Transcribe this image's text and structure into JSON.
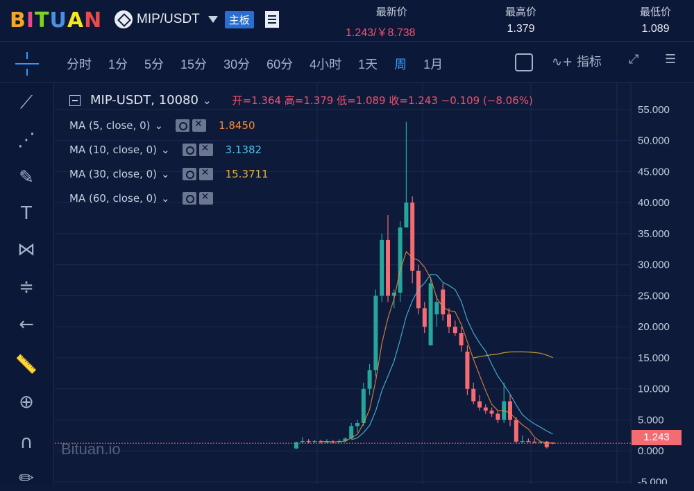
{
  "header": {
    "logo": "BITUAN",
    "pair": "MIP/USDT",
    "board": "主板",
    "latest_label": "最新价",
    "latest_value": "1.243/￥8.738",
    "high_label": "最高价",
    "high_value": "1.379",
    "low_label": "最低价",
    "low_value": "1.089"
  },
  "toolbar": {
    "intervals": [
      "分时",
      "1分",
      "5分",
      "15分",
      "30分",
      "60分",
      "4小时",
      "1天",
      "周",
      "1月"
    ],
    "active_interval": "周",
    "indicator_label": "指标"
  },
  "legend": {
    "symbol": "MIP-USDT, 10080",
    "ohlc_text": "开=1.364  高=1.379  低=1.089  收=1.243  −0.109 (−8.06%)",
    "ma": [
      {
        "label": "MA (5, close, 0)",
        "value": "1.8450",
        "color": "#f08a3c"
      },
      {
        "label": "MA (10, close, 0)",
        "value": "3.1382",
        "color": "#4fc3e8"
      },
      {
        "label": "MA (30, close, 0)",
        "value": "15.3711",
        "color": "#e0b030"
      },
      {
        "label": "MA (60, close, 0)",
        "value": "",
        "color": "#c7d0e0"
      }
    ]
  },
  "watermark": "Bituan.io",
  "last_price_badge": "1.243",
  "colors": {
    "up": "#26a69a",
    "down": "#f56b72",
    "bg": "#0d1a3a"
  },
  "chart_data": {
    "type": "candlestick",
    "ylim": [
      -5,
      57
    ],
    "yticks": [
      "55.000",
      "50.000",
      "45.000",
      "40.000",
      "35.000",
      "30.000",
      "25.000",
      "20.000",
      "15.000",
      "10.000",
      "5.000",
      "0.000",
      "-5.000"
    ],
    "ytick_values": [
      55,
      50,
      45,
      40,
      35,
      30,
      25,
      20,
      15,
      10,
      5,
      0,
      -5
    ],
    "candles": [
      [
        0.4,
        1.5,
        0.3,
        1.4
      ],
      [
        1.4,
        2.2,
        1.2,
        1.6
      ],
      [
        1.6,
        1.9,
        1.2,
        1.5
      ],
      [
        1.5,
        1.8,
        1.3,
        1.6
      ],
      [
        1.6,
        1.8,
        1.2,
        1.4
      ],
      [
        1.4,
        1.9,
        1.3,
        1.5
      ],
      [
        1.5,
        1.8,
        1.3,
        1.4
      ],
      [
        1.4,
        1.9,
        1.3,
        1.6
      ],
      [
        1.6,
        2.2,
        1.4,
        2.0
      ],
      [
        2.0,
        4.5,
        1.9,
        4.0
      ],
      [
        4.0,
        5.0,
        3.0,
        4.5
      ],
      [
        4.5,
        11.0,
        4.0,
        10.0
      ],
      [
        10.0,
        14.0,
        9.0,
        13.0
      ],
      [
        13.0,
        26.0,
        12.0,
        25.0
      ],
      [
        25.0,
        35.0,
        24.0,
        34.0
      ],
      [
        34.0,
        38.0,
        24.0,
        25.0
      ],
      [
        25.0,
        26.0,
        23.0,
        25.5
      ],
      [
        25.5,
        37.0,
        24.0,
        36.0
      ],
      [
        36.0,
        53.0,
        36.0,
        40.0
      ],
      [
        40.0,
        41.0,
        27.0,
        29.0
      ],
      [
        29.0,
        30.0,
        22.0,
        23.0
      ],
      [
        23.0,
        24.0,
        19.0,
        20.0
      ],
      [
        17.0,
        28.0,
        17.0,
        27.0
      ],
      [
        22.0,
        25.0,
        20.0,
        24.0
      ],
      [
        26.0,
        27.0,
        21.0,
        22.0
      ],
      [
        22.0,
        23.0,
        19.0,
        20.0
      ],
      [
        20.0,
        21.0,
        18.5,
        19.0
      ],
      [
        19.0,
        20.0,
        16.0,
        17.0
      ],
      [
        16.0,
        17.0,
        9.0,
        10.0
      ],
      [
        10.0,
        11.0,
        7.5,
        8.0
      ],
      [
        8.0,
        9.0,
        6.5,
        7.0
      ],
      [
        7.0,
        7.5,
        6.0,
        6.5
      ],
      [
        6.5,
        7.0,
        5.5,
        6.0
      ],
      [
        6.0,
        6.5,
        4.5,
        5.0
      ],
      [
        5.0,
        11.0,
        4.5,
        8.0
      ],
      [
        8.0,
        9.0,
        4.0,
        5.0
      ],
      [
        5.0,
        5.5,
        1.2,
        1.5
      ],
      [
        1.5,
        2.5,
        1.3,
        1.6
      ],
      [
        1.6,
        2.0,
        1.4,
        1.5
      ],
      [
        1.5,
        2.0,
        1.3,
        1.4
      ],
      [
        1.4,
        1.6,
        1.2,
        1.5
      ],
      [
        1.5,
        1.6,
        0.4,
        0.6
      ],
      [
        1.364,
        1.379,
        1.089,
        1.243
      ]
    ]
  }
}
